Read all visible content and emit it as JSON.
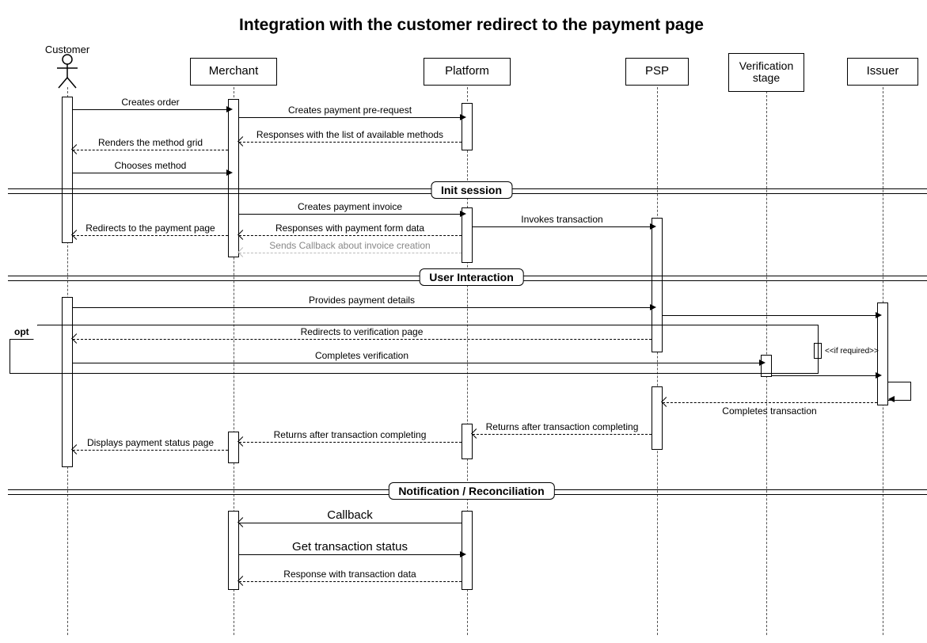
{
  "title": "Integration with the customer redirect to the payment page",
  "participants": {
    "customer": "Customer",
    "merchant": "Merchant",
    "platform": "Platform",
    "psp": "PSP",
    "verification": "Verification\nstage",
    "issuer": "Issuer"
  },
  "dividers": {
    "init": "Init session",
    "userInteraction": "User Interaction",
    "notify": "Notification / Reconciliation"
  },
  "opt": {
    "label": "opt",
    "guard": "<<if required>>"
  },
  "messages": {
    "m1": "Creates order",
    "m2": "Creates payment pre-request",
    "m3": "Responses with the list of available methods",
    "m4": "Renders the method grid",
    "m5": "Chooses method",
    "m6": "Creates payment invoice",
    "m7": "Responses with payment form data",
    "m8": "Sends Callback about invoice creation",
    "m9": "Invokes transaction",
    "m10": "Redirects to the payment page",
    "m11": "Provides payment details",
    "m12": "Redirects to verification page",
    "m13": "Completes verification",
    "m14": "Completes transaction",
    "m15": "Returns after transaction completing",
    "m16": "Returns after transaction completing",
    "m17": "Displays payment status page",
    "m18": "Callback",
    "m19": "Get transaction status",
    "m20": "Response with transaction data"
  },
  "chart_data": {
    "type": "sequence-diagram",
    "title": "Integration with the customer redirect to the payment page",
    "participants": [
      "Customer",
      "Merchant",
      "Platform",
      "PSP",
      "Verification stage",
      "Issuer"
    ],
    "fragments": [
      {
        "type": "messages",
        "items": [
          {
            "from": "Customer",
            "to": "Merchant",
            "label": "Creates order",
            "style": "sync"
          },
          {
            "from": "Merchant",
            "to": "Platform",
            "label": "Creates payment pre-request",
            "style": "sync"
          },
          {
            "from": "Platform",
            "to": "Merchant",
            "label": "Responses with the list of available methods",
            "style": "return"
          },
          {
            "from": "Merchant",
            "to": "Customer",
            "label": "Renders the method grid",
            "style": "return"
          },
          {
            "from": "Customer",
            "to": "Merchant",
            "label": "Chooses method",
            "style": "sync"
          }
        ]
      },
      {
        "type": "divider",
        "label": "Init session"
      },
      {
        "type": "messages",
        "items": [
          {
            "from": "Merchant",
            "to": "Platform",
            "label": "Creates payment invoice",
            "style": "sync"
          },
          {
            "from": "Platform",
            "to": "PSP",
            "label": "Invokes transaction",
            "style": "sync"
          },
          {
            "from": "Platform",
            "to": "Merchant",
            "label": "Responses with payment form data",
            "style": "return"
          },
          {
            "from": "Platform",
            "to": "Merchant",
            "label": "Sends Callback about invoice creation",
            "style": "return-dim"
          },
          {
            "from": "Merchant",
            "to": "Customer",
            "label": "Redirects to the payment page",
            "style": "return"
          }
        ]
      },
      {
        "type": "divider",
        "label": "User Interaction"
      },
      {
        "type": "messages",
        "items": [
          {
            "from": "Customer",
            "to": "PSP",
            "label": "Provides payment details",
            "style": "sync"
          },
          {
            "from": "PSP",
            "to": "Issuer",
            "label": "",
            "style": "sync"
          }
        ]
      },
      {
        "type": "opt",
        "guard": "<<if required>>",
        "items": [
          {
            "from": "PSP",
            "to": "Customer",
            "label": "Redirects to verification page",
            "style": "return"
          },
          {
            "from": "Customer",
            "to": "Verification stage",
            "label": "Completes verification",
            "style": "sync"
          },
          {
            "from": "Verification stage",
            "to": "Issuer",
            "label": "",
            "style": "sync"
          }
        ]
      },
      {
        "type": "messages",
        "items": [
          {
            "from": "Issuer",
            "to": "Issuer",
            "label": "",
            "style": "self"
          },
          {
            "from": "Issuer",
            "to": "PSP",
            "label": "Completes transaction",
            "style": "return"
          },
          {
            "from": "PSP",
            "to": "Platform",
            "label": "Returns after transaction completing",
            "style": "return"
          },
          {
            "from": "Platform",
            "to": "Merchant",
            "label": "Returns after transaction completing",
            "style": "return"
          },
          {
            "from": "Merchant",
            "to": "Customer",
            "label": "Displays payment status page",
            "style": "return"
          }
        ]
      },
      {
        "type": "divider",
        "label": "Notification / Reconciliation"
      },
      {
        "type": "messages",
        "items": [
          {
            "from": "Platform",
            "to": "Merchant",
            "label": "Callback",
            "style": "sync-open"
          },
          {
            "from": "Merchant",
            "to": "Platform",
            "label": "Get transaction status",
            "style": "sync"
          },
          {
            "from": "Platform",
            "to": "Merchant",
            "label": "Response with transaction data",
            "style": "return"
          }
        ]
      }
    ]
  }
}
